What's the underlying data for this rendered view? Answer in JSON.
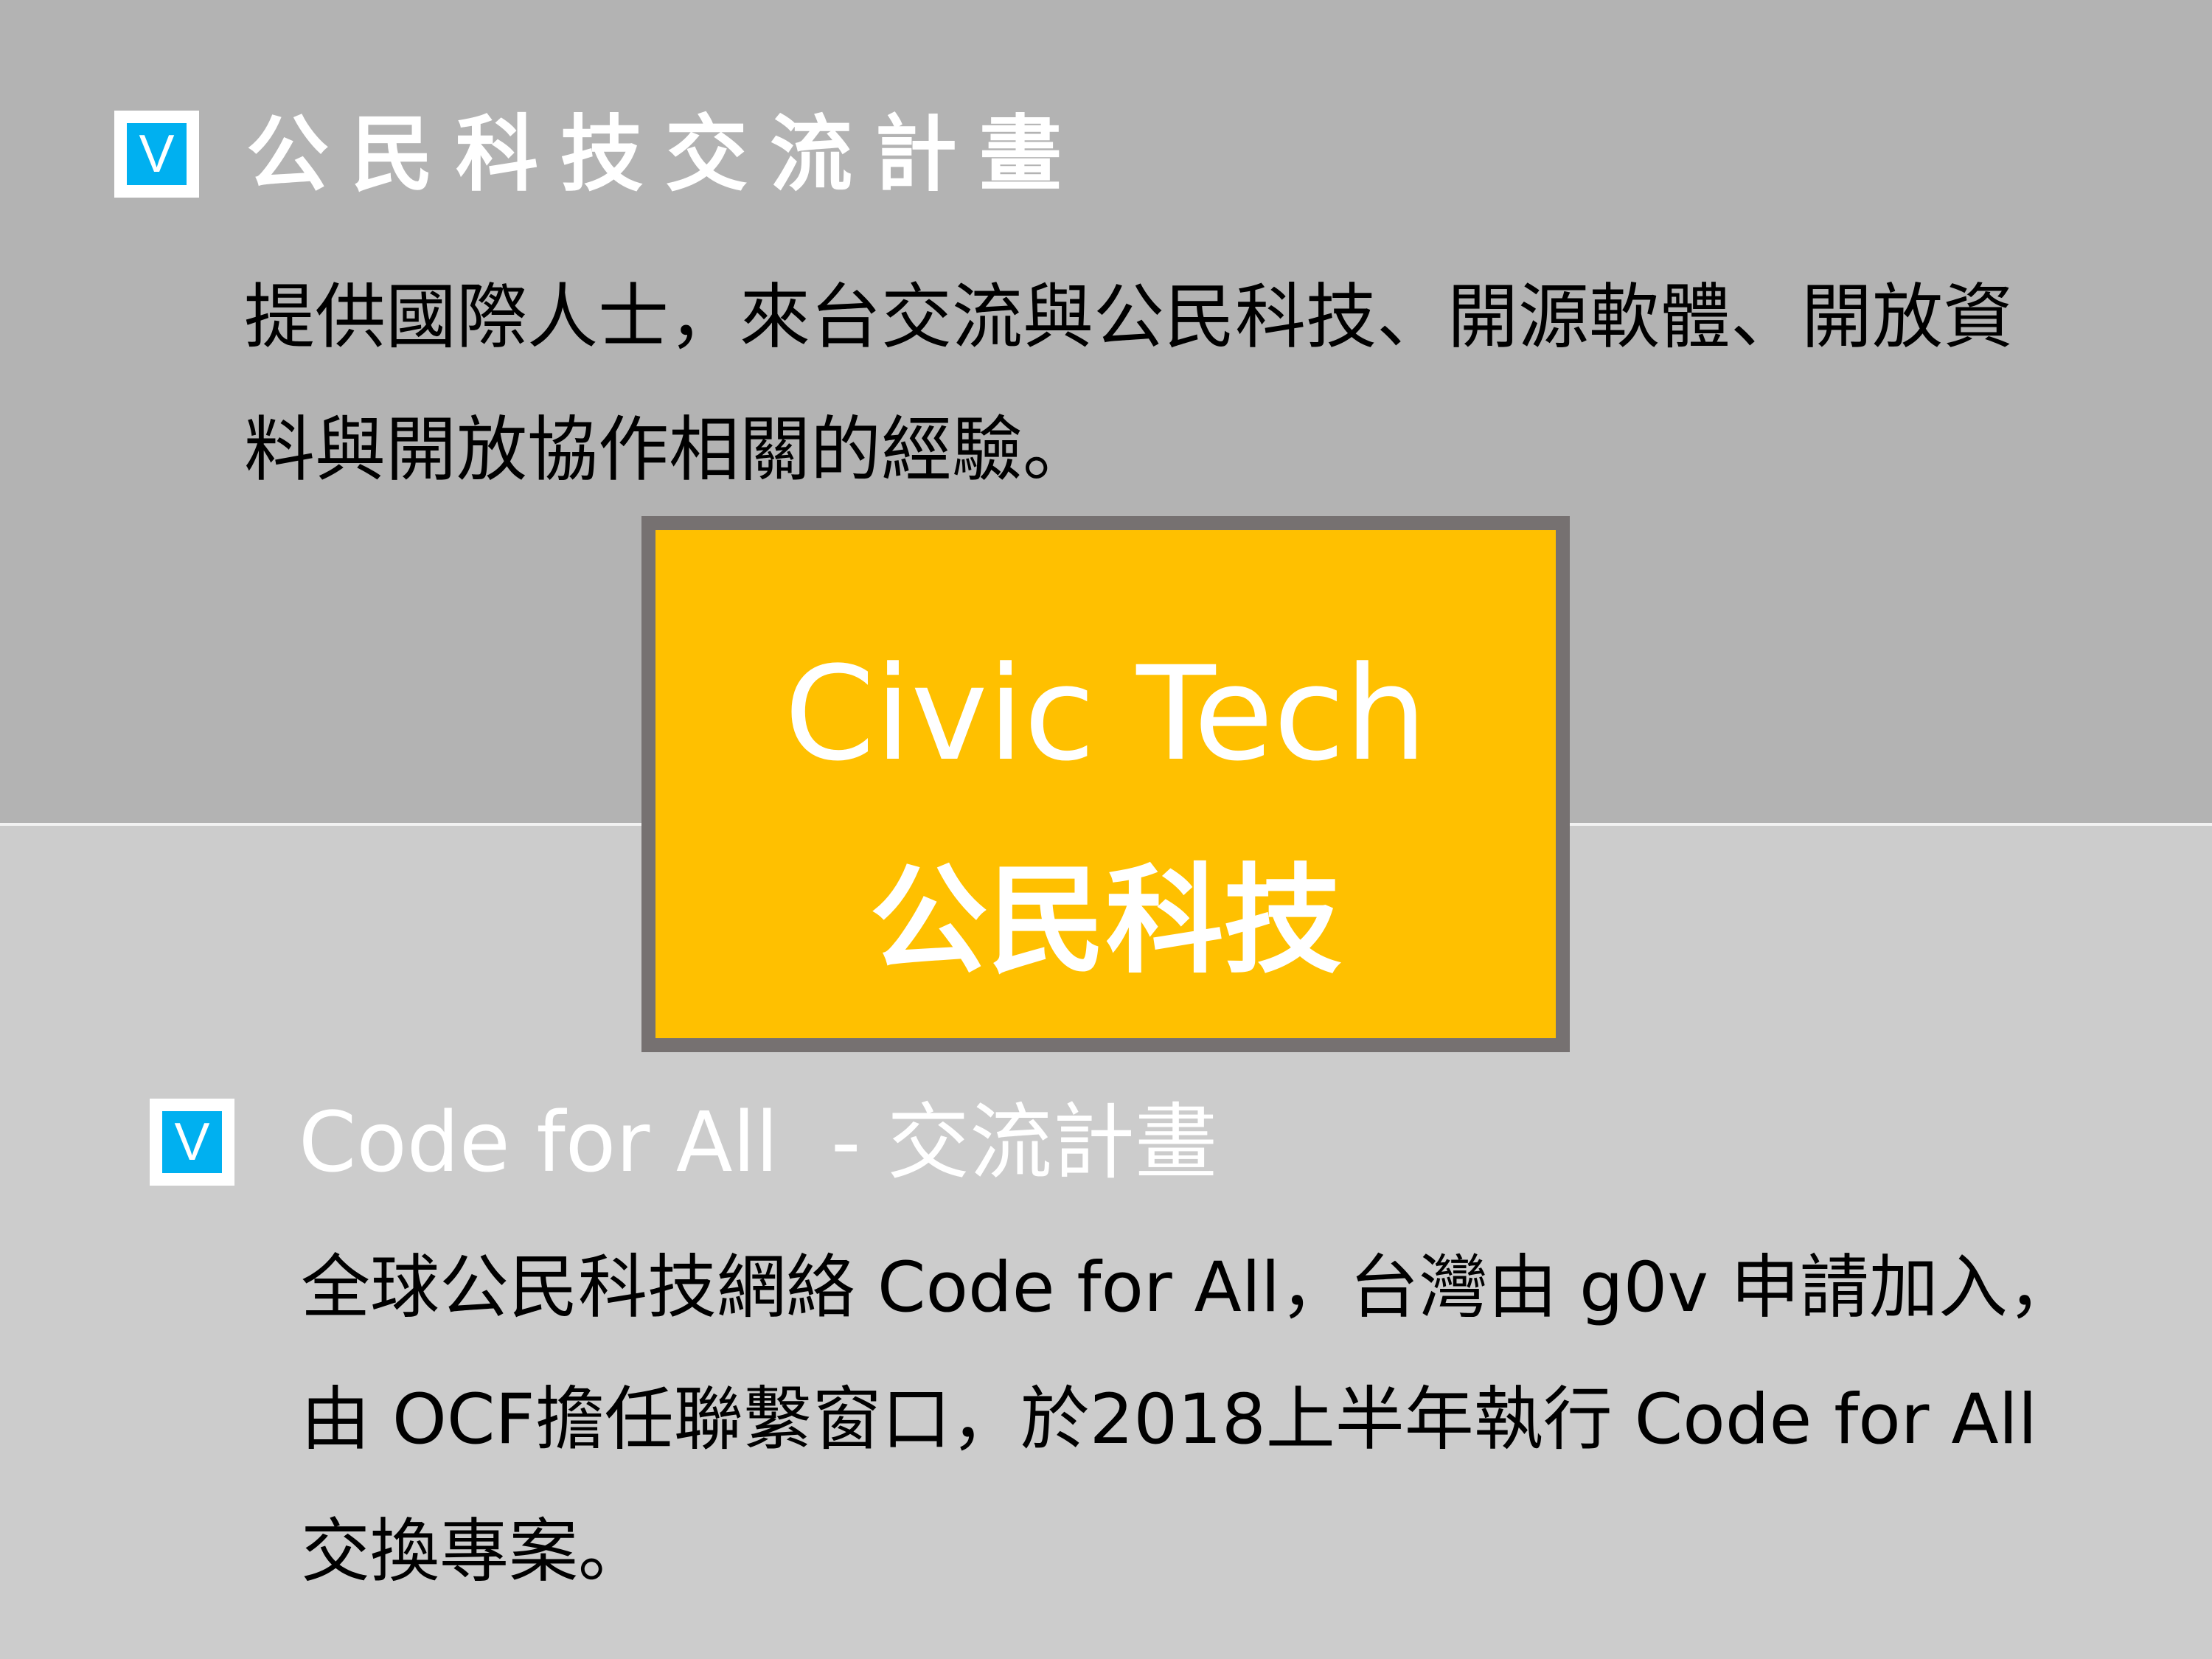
{
  "colors": {
    "top_bg": "#b3b3b3",
    "bottom_bg": "#cccccc",
    "accent_box": "#ffc000",
    "box_border": "#767171",
    "checkbox_blue": "#00b0f0"
  },
  "section1": {
    "checkbox_glyph": "V",
    "title": "公民科技交流計畫",
    "body_lines": [
      "提供國際人士，來台交流與公民科技、開源軟體、開放資",
      "料與開放協作相關的經驗。"
    ]
  },
  "center_box": {
    "line1": "Civic Tech",
    "line2": "公民科技"
  },
  "section2": {
    "checkbox_glyph": "V",
    "title": "Code for All  - 交流計畫",
    "body_lines": [
      "全球公民科技網絡 Code for All，台灣由 g0v 申請加入，",
      "由 OCF擔任聯繫窗口，於2018上半年執行 Code for All",
      "交換專案。"
    ]
  }
}
